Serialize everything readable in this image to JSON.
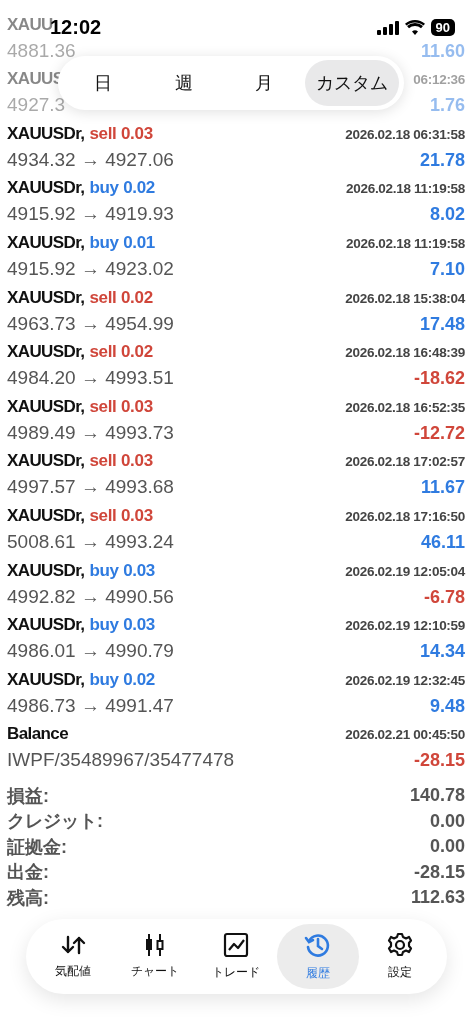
{
  "status_bar": {
    "time": "12:02",
    "battery": "90"
  },
  "faded_rows": [
    {
      "symbol": "XAUU",
      "prices": "4881.36",
      "profit": "11.60"
    },
    {
      "symbol": "XAUUS",
      "time": "06:12:36",
      "prices": "4927.3",
      "profit": "1.76"
    }
  ],
  "period_tabs": [
    {
      "label": "日",
      "selected": false
    },
    {
      "label": "週",
      "selected": false
    },
    {
      "label": "月",
      "selected": false
    },
    {
      "label": "カスタム",
      "selected": true
    }
  ],
  "trades": [
    {
      "symbol": "XAUUSDr,",
      "side": "sell",
      "lot": "0.03",
      "time": "2026.02.18 06:31:58",
      "prices": "4934.32 → 4927.06",
      "profit": "21.78",
      "positive": true
    },
    {
      "symbol": "XAUUSDr,",
      "side": "buy",
      "lot": "0.02",
      "time": "2026.02.18 11:19:58",
      "prices": "4915.92 → 4919.93",
      "profit": "8.02",
      "positive": true
    },
    {
      "symbol": "XAUUSDr,",
      "side": "buy",
      "lot": "0.01",
      "time": "2026.02.18 11:19:58",
      "prices": "4915.92 → 4923.02",
      "profit": "7.10",
      "positive": true
    },
    {
      "symbol": "XAUUSDr,",
      "side": "sell",
      "lot": "0.02",
      "time": "2026.02.18 15:38:04",
      "prices": "4963.73 → 4954.99",
      "profit": "17.48",
      "positive": true
    },
    {
      "symbol": "XAUUSDr,",
      "side": "sell",
      "lot": "0.02",
      "time": "2026.02.18 16:48:39",
      "prices": "4984.20 → 4993.51",
      "profit": "-18.62",
      "positive": false
    },
    {
      "symbol": "XAUUSDr,",
      "side": "sell",
      "lot": "0.03",
      "time": "2026.02.18 16:52:35",
      "prices": "4989.49 → 4993.73",
      "profit": "-12.72",
      "positive": false
    },
    {
      "symbol": "XAUUSDr,",
      "side": "sell",
      "lot": "0.03",
      "time": "2026.02.18 17:02:57",
      "prices": "4997.57 → 4993.68",
      "profit": "11.67",
      "positive": true
    },
    {
      "symbol": "XAUUSDr,",
      "side": "sell",
      "lot": "0.03",
      "time": "2026.02.18 17:16:50",
      "prices": "5008.61 → 4993.24",
      "profit": "46.11",
      "positive": true
    },
    {
      "symbol": "XAUUSDr,",
      "side": "buy",
      "lot": "0.03",
      "time": "2026.02.19 12:05:04",
      "prices": "4992.82 → 4990.56",
      "profit": "-6.78",
      "positive": false
    },
    {
      "symbol": "XAUUSDr,",
      "side": "buy",
      "lot": "0.03",
      "time": "2026.02.19 12:10:59",
      "prices": "4986.01 → 4990.79",
      "profit": "14.34",
      "positive": true
    },
    {
      "symbol": "XAUUSDr,",
      "side": "buy",
      "lot": "0.02",
      "time": "2026.02.19 12:32:45",
      "prices": "4986.73 → 4991.47",
      "profit": "9.48",
      "positive": true
    }
  ],
  "balance": {
    "label": "Balance",
    "time": "2026.02.21 00:45:50",
    "comment": "IWPF/35489967/35477478",
    "amount": "-28.15",
    "positive": false
  },
  "summary": [
    {
      "label": "損益:",
      "value": "140.78"
    },
    {
      "label": "クレジット:",
      "value": "0.00"
    },
    {
      "label": "証拠金:",
      "value": "0.00"
    },
    {
      "label": "出金:",
      "value": "-28.15"
    },
    {
      "label": "残高:",
      "value": "112.63"
    }
  ],
  "nav": [
    {
      "kind": "quotes",
      "label": "気配値",
      "selected": false
    },
    {
      "kind": "chart",
      "label": "チャート",
      "selected": false
    },
    {
      "kind": "trade",
      "label": "トレード",
      "selected": false
    },
    {
      "kind": "history",
      "label": "履歴",
      "selected": true
    },
    {
      "kind": "settings",
      "label": "設定",
      "selected": false
    }
  ]
}
